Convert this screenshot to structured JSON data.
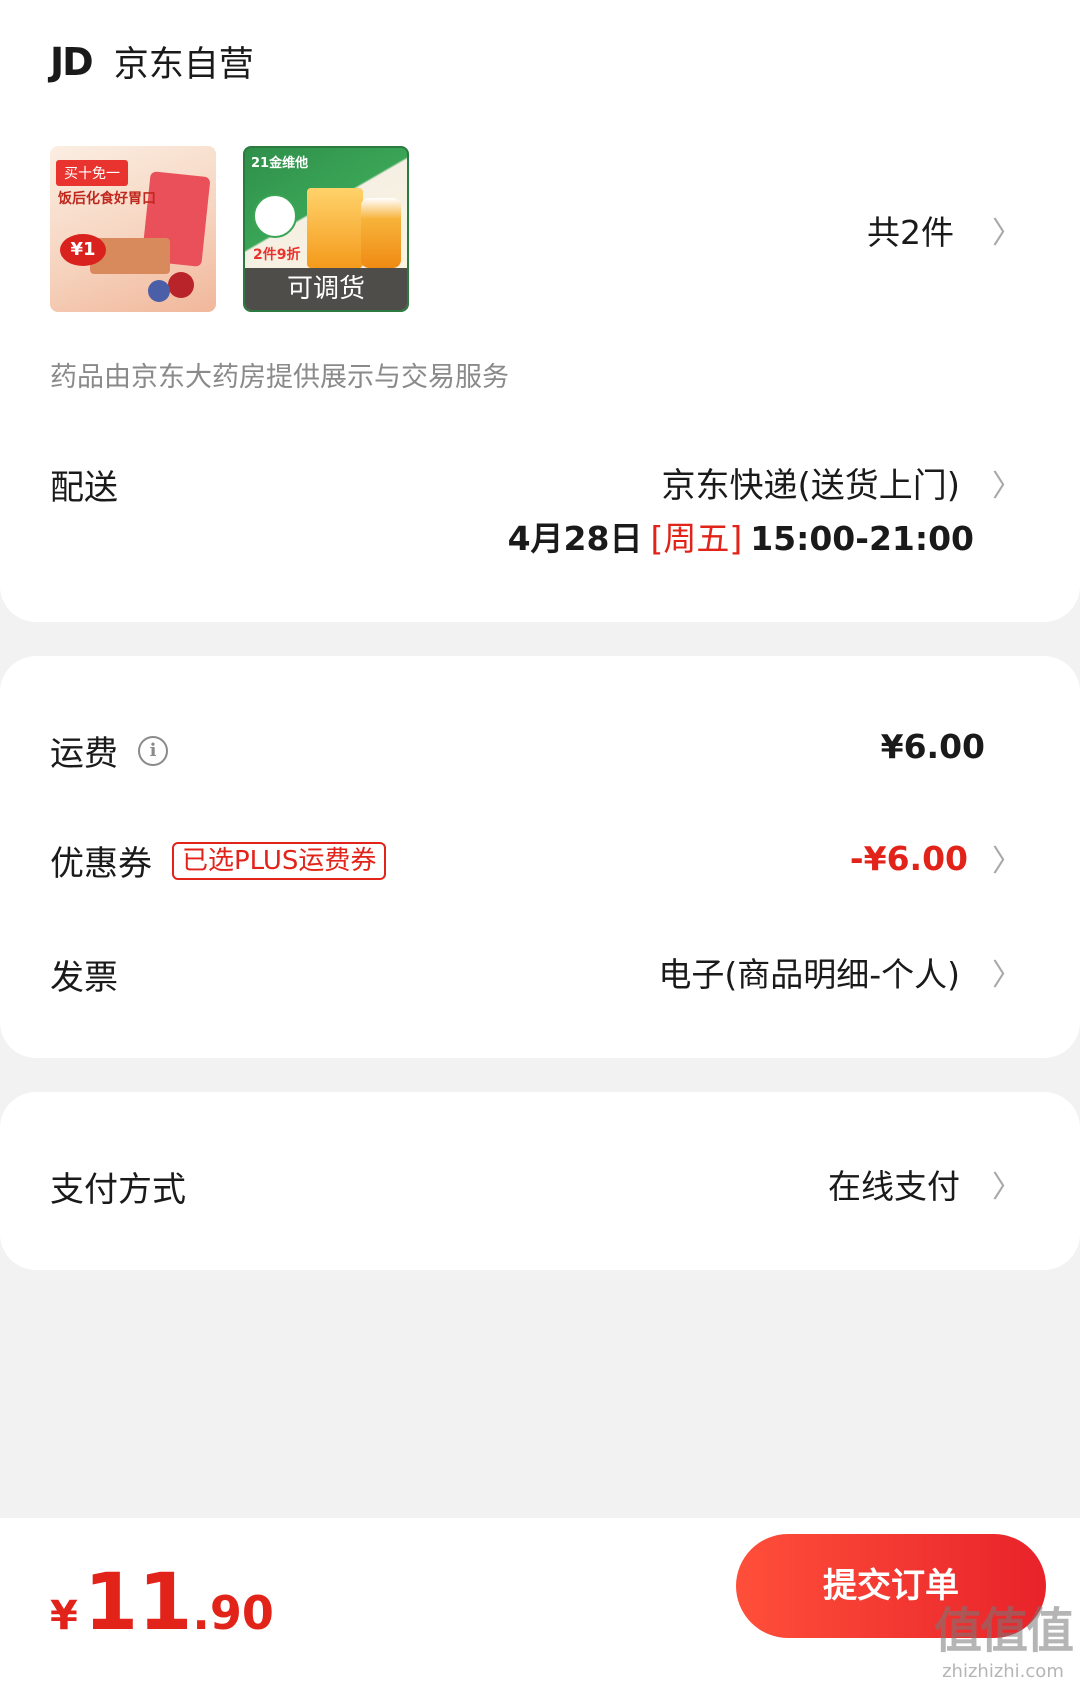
{
  "store": {
    "logo_text": "JD",
    "name": "京东自营",
    "item_count": "共2件",
    "pharmacy_note": "药品由京东大药房提供展示与交易服务",
    "products": [
      {
        "tag": "买十免一",
        "headline": "饭后化食好胃口",
        "price_badge": "¥1"
      },
      {
        "brand": "21金维他",
        "offer": "2件9折",
        "overlay": "可调货"
      }
    ]
  },
  "delivery": {
    "label": "配送",
    "method": "京东快递(送货上门)",
    "date": "4月28日",
    "weekday": "[周五]",
    "time_range": "15:00-21:00"
  },
  "fees": {
    "shipping_label": "运费",
    "shipping_value": "¥6.00",
    "coupon_label": "优惠券",
    "coupon_badge": "已选PLUS运费券",
    "coupon_value": "-¥6.00",
    "invoice_label": "发票",
    "invoice_value": "电子(商品明细-个人)"
  },
  "payment": {
    "label": "支付方式",
    "value": "在线支付"
  },
  "footer": {
    "currency": "¥",
    "total_int": "11",
    "total_dec": ".90",
    "submit_label": "提交订单",
    "watermark_big": "值值值",
    "watermark_small": "zhizhizhi.com"
  },
  "colors": {
    "accent_red": "#e2231a",
    "page_background": "#f2f2f2",
    "card_background": "#ffffff"
  }
}
